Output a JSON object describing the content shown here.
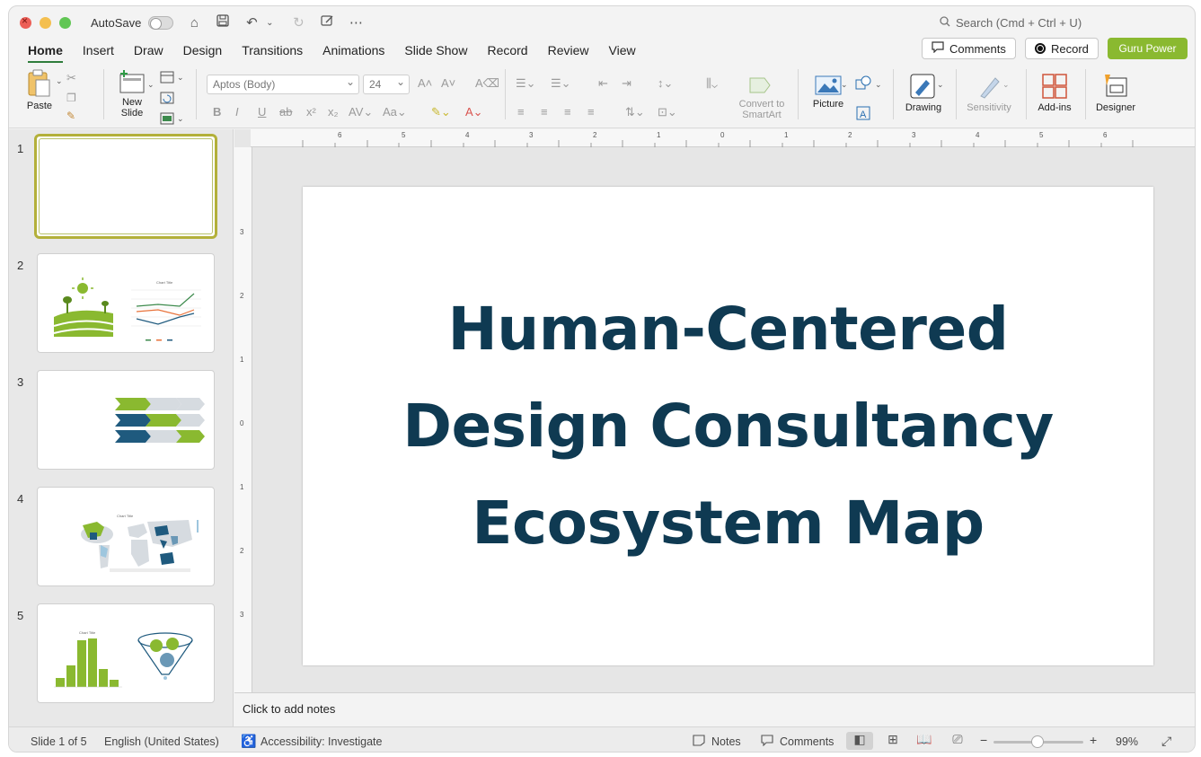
{
  "titlebar": {
    "autosave_label": "AutoSave",
    "search_placeholder": "Search (Cmd + Ctrl + U)"
  },
  "menu": {
    "tabs": [
      "Home",
      "Insert",
      "Draw",
      "Design",
      "Transitions",
      "Animations",
      "Slide Show",
      "Record",
      "Review",
      "View"
    ],
    "active": "Home"
  },
  "header_buttons": {
    "comments": "Comments",
    "record": "Record",
    "guru": "Guru Power"
  },
  "ribbon": {
    "paste": "Paste",
    "new_slide_line1": "New",
    "new_slide_line2": "Slide",
    "font_name": "Aptos (Body)",
    "font_size": "24",
    "convert_line1": "Convert to",
    "convert_line2": "SmartArt",
    "picture": "Picture",
    "drawing": "Drawing",
    "sensitivity": "Sensitivity",
    "addins": "Add-ins",
    "designer": "Designer"
  },
  "slides": {
    "numbers": [
      "1",
      "2",
      "3",
      "4",
      "5"
    ],
    "selected": 1,
    "thumb2_chart_title": "Chart Title",
    "thumb4_chart_title": "Chart Title",
    "thumb5_chart_title": "Chart Title"
  },
  "ruler": {
    "h_labels": [
      "6",
      "5",
      "4",
      "3",
      "2",
      "1",
      "0",
      "1",
      "2",
      "3",
      "4",
      "5",
      "6"
    ],
    "v_labels": [
      "3",
      "2",
      "1",
      "0",
      "1",
      "2",
      "3"
    ]
  },
  "slide": {
    "title_line1": "Human-Centered",
    "title_line2": "Design Consultancy",
    "title_line3": "Ecosystem Map",
    "title_color": "#0f3a52"
  },
  "notes": {
    "placeholder": "Click to add notes"
  },
  "status": {
    "slide_count": "Slide 1 of 5",
    "language": "English (United States)",
    "accessibility": "Accessibility: Investigate",
    "notes": "Notes",
    "comments": "Comments",
    "zoom": "99%"
  },
  "colors": {
    "accent_green": "#8ab930",
    "navy": "#1f5a7e",
    "light_gray": "#d6dbe0"
  }
}
